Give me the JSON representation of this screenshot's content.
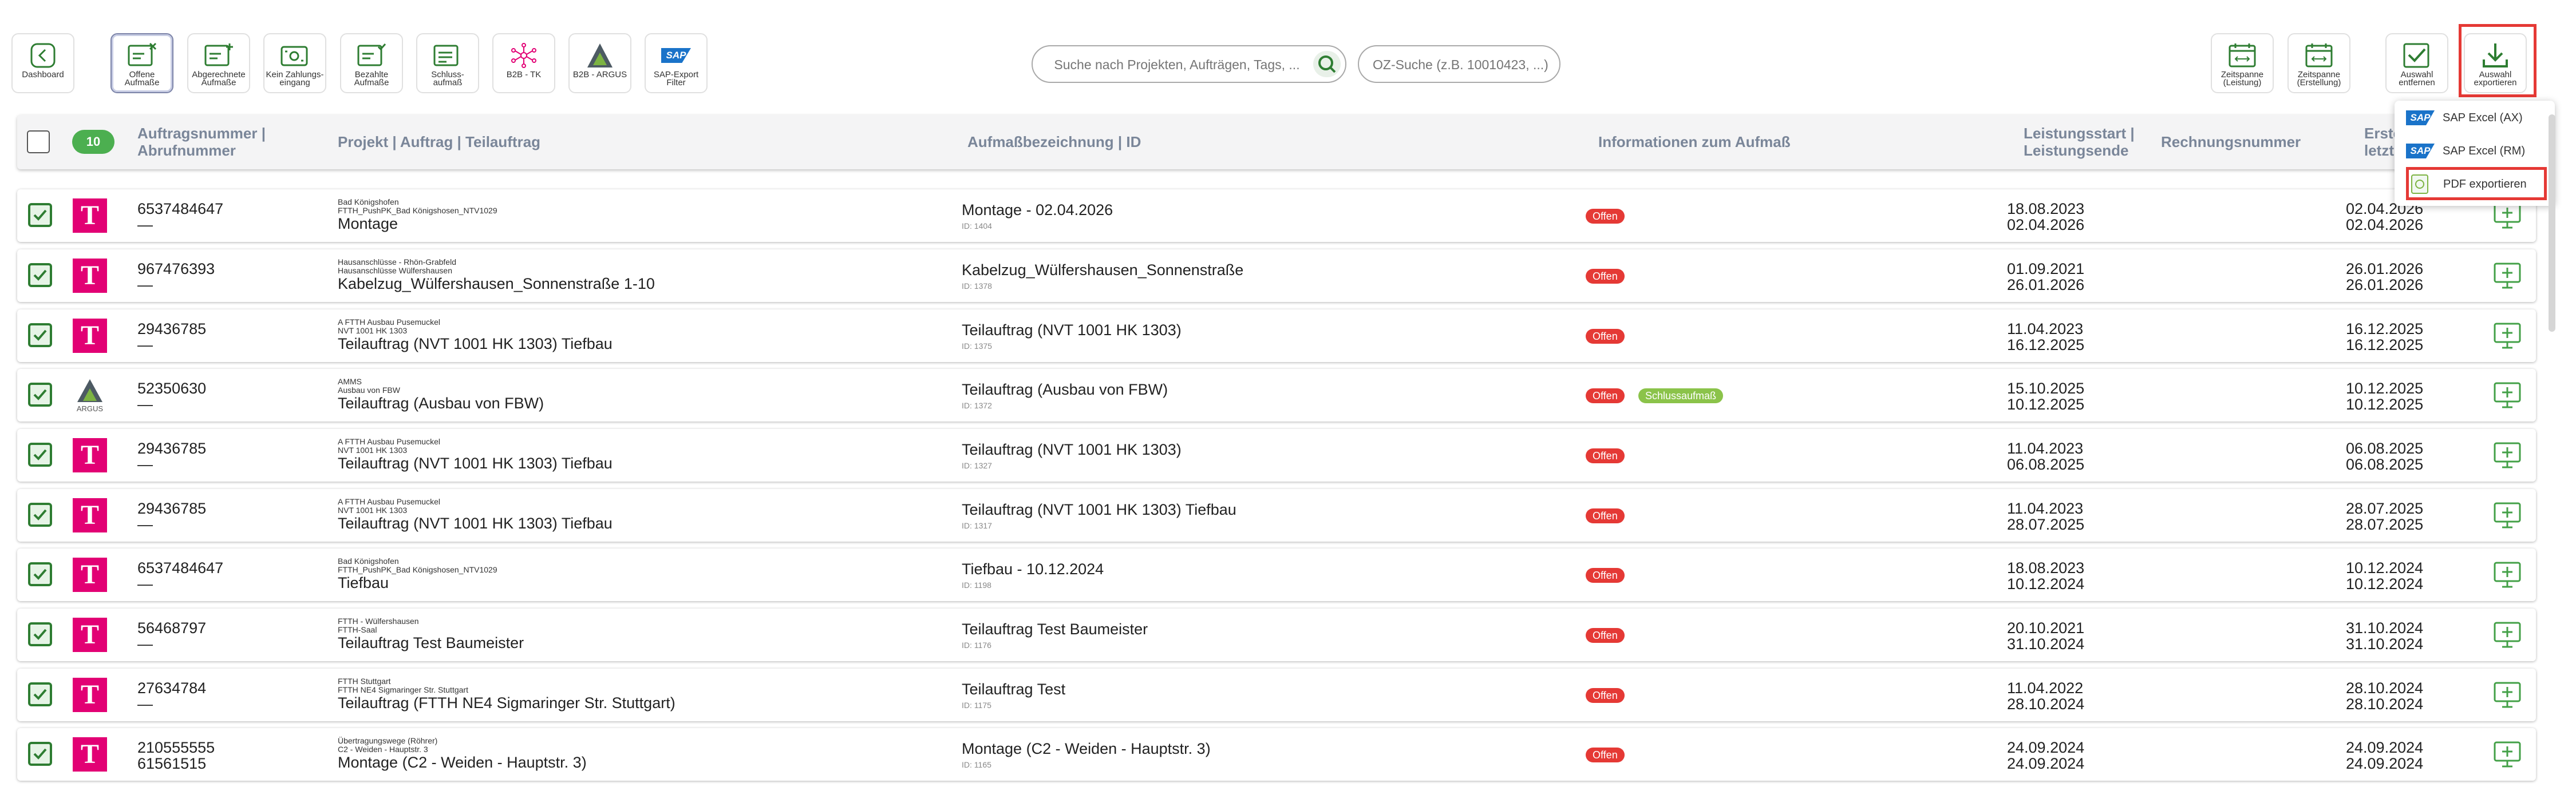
{
  "toolbar": {
    "buttons": [
      {
        "label": "Dashboard"
      },
      {
        "label": "Offene\nAufmaße"
      },
      {
        "label": "Abgerechnete\nAufmaße"
      },
      {
        "label": "Kein Zahlungs-\neingang"
      },
      {
        "label": "Bezahlte\nAufmaße"
      },
      {
        "label": "Schluss-\naufmaß"
      },
      {
        "label": "B2B - TK"
      },
      {
        "label": "B2B - ARGUS"
      },
      {
        "label": "SAP-Export\nFilter"
      }
    ],
    "right_buttons": [
      {
        "label": "Zeitspanne\n(Leistung)"
      },
      {
        "label": "Zeitspanne\n(Erstellung)"
      },
      {
        "label": "Auswahl\nentfernen"
      },
      {
        "label": "Auswahl\nexportieren"
      }
    ],
    "sap_logo": "SAP"
  },
  "search": {
    "placeholder": "Suche nach Projekten, Aufträgen, Tags, ..."
  },
  "oz_search": {
    "placeholder": "OZ-Suche (z.B. 10010423, ...)"
  },
  "dropdown": {
    "sap_logo": "SAP",
    "items": [
      {
        "label": "SAP Excel (AX)"
      },
      {
        "label": "SAP Excel (RM)"
      },
      {
        "label": "PDF exportieren"
      }
    ]
  },
  "table": {
    "selected_count": "10",
    "headers": {
      "auftrag": "Auftragsnummer |",
      "abruf": "Abrufnummer",
      "projekt": "Projekt | Auftrag | Teilauftrag",
      "aufmass": "Aufmaßbezeichnung | ID",
      "info": "Informationen zum Aufmaß",
      "leistung1": "Leistungsstart |",
      "leistung2": "Leistungsende",
      "rechnung": "Rechnungsnummer",
      "erst1": "Erste",
      "erst2": "letzt"
    },
    "logo_t": "T",
    "logo_argus": "ARGUS",
    "rows": [
      {
        "auftrag": "6537484647",
        "abruf": "—",
        "sub1": "Bad Königshofen",
        "sub2": "FTTH_PushPK_Bad Königshosen_NTV1029",
        "main": "Montage",
        "aufmass": "Montage - 02.04.2026",
        "id": "ID: 1404",
        "status": "Offen",
        "start": "18.08.2023",
        "ende": "02.04.2026",
        "c1": "02.04.2026",
        "c2": "02.04.2026"
      },
      {
        "auftrag": "967476393",
        "abruf": "—",
        "sub1": "Hausanschlüsse - Rhön-Grabfeld",
        "sub2": "Hausanschlüsse Wülfershausen",
        "main": "Kabelzug_Wülfershausen_Sonnenstraße 1-10",
        "aufmass": "Kabelzug_Wülfershausen_Sonnenstraße",
        "id": "ID: 1378",
        "status": "Offen",
        "start": "01.09.2021",
        "ende": "26.01.2026",
        "c1": "26.01.2026",
        "c2": "26.01.2026"
      },
      {
        "auftrag": "29436785",
        "abruf": "—",
        "sub1": "A FTTH Ausbau Pusemuckel",
        "sub2": "NVT 1001 HK 1303",
        "main": "Teilauftrag (NVT 1001 HK 1303) Tiefbau",
        "aufmass": "Teilauftrag (NVT 1001 HK 1303)",
        "id": "ID: 1375",
        "status": "Offen",
        "start": "11.04.2023",
        "ende": "16.12.2025",
        "c1": "16.12.2025",
        "c2": "16.12.2025"
      },
      {
        "auftrag": "52350630",
        "abruf": "—",
        "sub1": "AMMS",
        "sub2": "Ausbau von FBW",
        "main": "Teilauftrag (Ausbau von FBW)",
        "aufmass": "Teilauftrag (Ausbau von FBW)",
        "id": "ID: 1372",
        "status": "Offen",
        "status2": "Schlussaufmaß",
        "start": "15.10.2025",
        "ende": "10.12.2025",
        "c1": "10.12.2025",
        "c2": "10.12.2025"
      },
      {
        "auftrag": "29436785",
        "abruf": "—",
        "sub1": "A FTTH Ausbau Pusemuckel",
        "sub2": "NVT 1001 HK 1303",
        "main": "Teilauftrag (NVT 1001 HK 1303) Tiefbau",
        "aufmass": "Teilauftrag (NVT 1001 HK 1303)",
        "id": "ID: 1327",
        "status": "Offen",
        "start": "11.04.2023",
        "ende": "06.08.2025",
        "c1": "06.08.2025",
        "c2": "06.08.2025"
      },
      {
        "auftrag": "29436785",
        "abruf": "—",
        "sub1": "A FTTH Ausbau Pusemuckel",
        "sub2": "NVT 1001 HK 1303",
        "main": "Teilauftrag (NVT 1001 HK 1303) Tiefbau",
        "aufmass": "Teilauftrag (NVT 1001 HK 1303) Tiefbau",
        "id": "ID: 1317",
        "status": "Offen",
        "start": "11.04.2023",
        "ende": "28.07.2025",
        "c1": "28.07.2025",
        "c2": "28.07.2025"
      },
      {
        "auftrag": "6537484647",
        "abruf": "—",
        "sub1": "Bad Königshofen",
        "sub2": "FTTH_PushPK_Bad Königshosen_NTV1029",
        "main": "Tiefbau",
        "aufmass": "Tiefbau - 10.12.2024",
        "id": "ID: 1198",
        "status": "Offen",
        "start": "18.08.2023",
        "ende": "10.12.2024",
        "c1": "10.12.2024",
        "c2": "10.12.2024"
      },
      {
        "auftrag": "56468797",
        "abruf": "—",
        "sub1": "FTTH - Wülfershausen",
        "sub2": "FTTH-Saal",
        "main": "Teilauftrag Test Baumeister",
        "aufmass": "Teilauftrag Test Baumeister",
        "id": "ID: 1176",
        "status": "Offen",
        "start": "20.10.2021",
        "ende": "31.10.2024",
        "c1": "31.10.2024",
        "c2": "31.10.2024"
      },
      {
        "auftrag": "27634784",
        "abruf": "—",
        "sub1": "FTTH Stuttgart",
        "sub2": "FTTH NE4 Sigmaringer Str. Stuttgart",
        "main": "Teilauftrag (FTTH NE4 Sigmaringer Str. Stuttgart)",
        "aufmass": "Teilauftrag Test",
        "id": "ID: 1175",
        "status": "Offen",
        "start": "11.04.2022",
        "ende": "28.10.2024",
        "c1": "28.10.2024",
        "c2": "28.10.2024"
      },
      {
        "auftrag": "210555555",
        "abruf": "61561515",
        "sub1": "Übertragungswege (Röhrer)",
        "sub2": "C2 - Weiden - Hauptstr. 3",
        "main": "Montage (C2 - Weiden - Hauptstr. 3)",
        "aufmass": "Montage (C2 - Weiden - Hauptstr. 3)",
        "id": "ID: 1165",
        "status": "Offen",
        "start": "24.09.2024",
        "ende": "24.09.2024",
        "c1": "24.09.2024",
        "c2": "24.09.2024"
      }
    ]
  }
}
